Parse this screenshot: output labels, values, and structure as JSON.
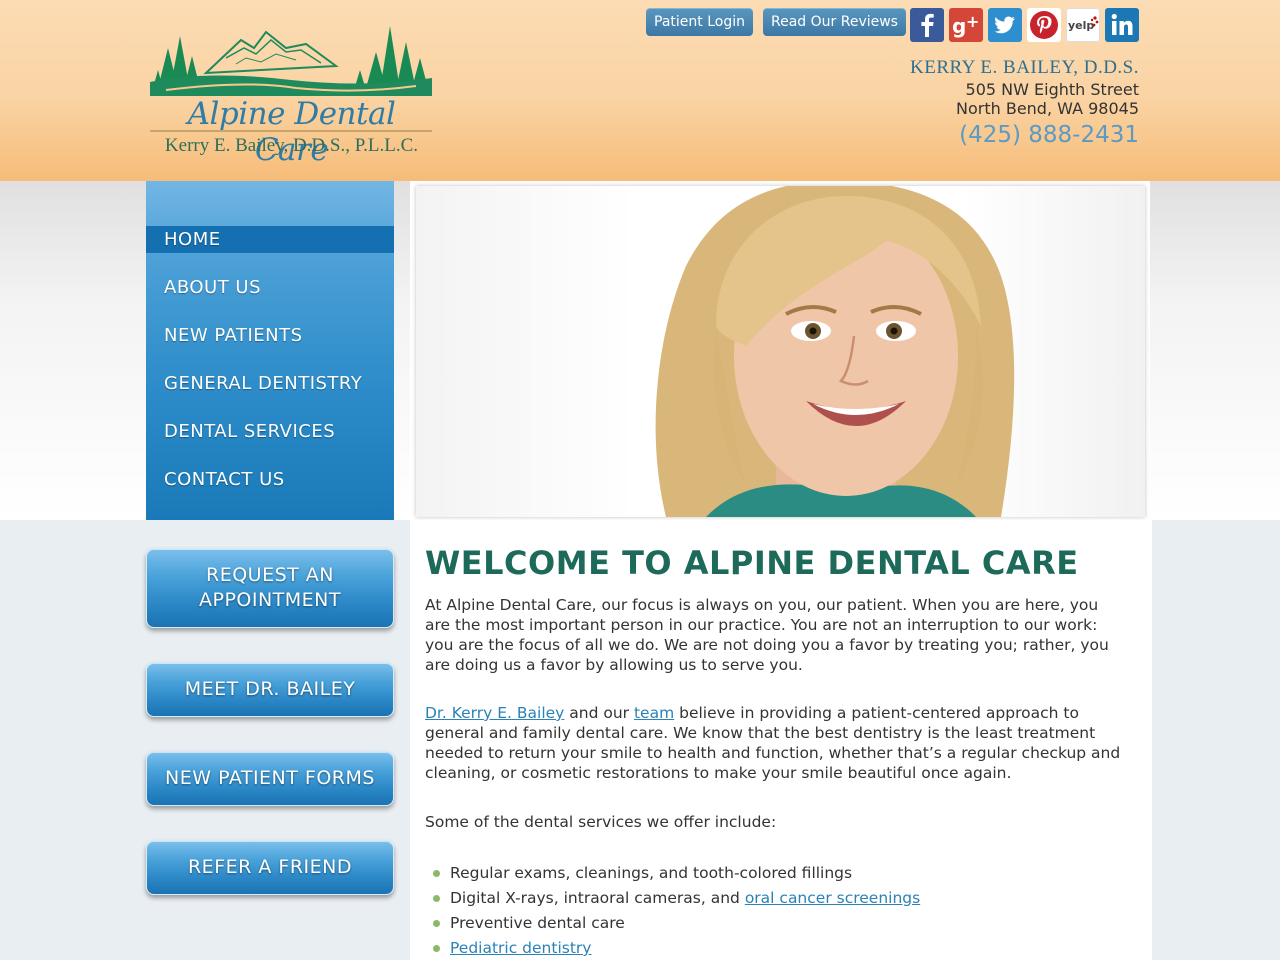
{
  "logo": {
    "title": "Alpine Dental Care",
    "subtitle": "Kerry E. Bailey, D.D.S., P.L.L.C."
  },
  "header": {
    "patient_login": "Patient Login",
    "read_reviews": "Read Our Reviews",
    "social": [
      "facebook-icon",
      "google-plus-icon",
      "twitter-icon",
      "pinterest-icon",
      "yelp-icon",
      "linkedin-icon"
    ],
    "doctor": "KERRY E. BAILEY, D.D.S.",
    "address_line1": "505 NW Eighth Street",
    "address_line2": "North Bend, WA 98045",
    "phone": "(425) 888-2431"
  },
  "nav": {
    "items": [
      {
        "label": "HOME"
      },
      {
        "label": "ABOUT US"
      },
      {
        "label": "NEW PATIENTS"
      },
      {
        "label": "GENERAL DENTISTRY"
      },
      {
        "label": "DENTAL SERVICES"
      },
      {
        "label": "CONTACT US"
      }
    ]
  },
  "sidebar": {
    "request_line1": "REQUEST AN",
    "request_line2": "APPOINTMENT",
    "meet": "MEET DR. BAILEY",
    "forms": "NEW PATIENT FORMS",
    "refer": "REFER A FRIEND"
  },
  "main": {
    "heading": "WELCOME TO ALPINE DENTAL CARE",
    "para1": "At Alpine Dental Care, our focus is always on you, our patient. When you are here, you are the most important person in our practice. You are not an interruption to our work: you are the focus of all we do. We are not doing you a favor by treating you; rather, you are doing us a favor by allowing us to serve you.",
    "para2_link1": "Dr. Kerry E. Bailey",
    "para2_text1": " and our ",
    "para2_link2": "team",
    "para2_text2": " believe in providing a patient-centered approach to general and family dental care. We know that the best dentistry is the least treatment needed to return your smile to health and function, whether that’s a regular checkup and cleaning, or cosmetic restorations to make your smile beautiful once again.",
    "para3": "Some of the dental services we offer include:",
    "list_item1": "Regular exams, cleanings, and tooth-colored fillings",
    "list_item2_text": "Digital X-rays, intraoral cameras, and ",
    "list_item2_link": "oral cancer screenings",
    "list_item3": "Preventive dental care",
    "list_item4_link": "Pediatric dentistry"
  },
  "colors": {
    "accent_blue": "#2b87c6",
    "heading_green": "#1e6a5a",
    "link_blue": "#2a82b8",
    "header_peach": "#fad3a3"
  }
}
